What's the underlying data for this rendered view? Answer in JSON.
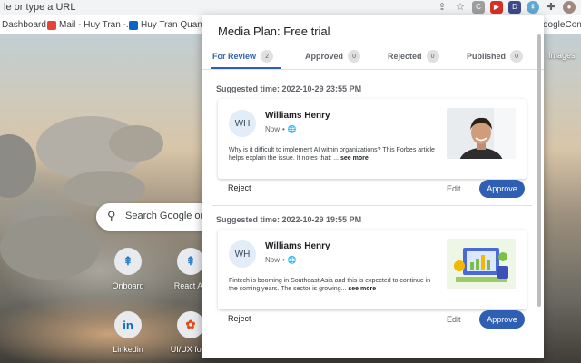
{
  "browser": {
    "omnibox_text": "le or type a URL",
    "toolbar_icons": [
      "share-icon",
      "star-icon",
      "extension-icon",
      "puzzle-icon",
      "profile-icon"
    ],
    "bookmarks": [
      {
        "label": "Dashboard",
        "icon": "dashboard-icon"
      },
      {
        "label": "Mail - Huy Tran -...",
        "icon": "gmail-icon"
      },
      {
        "label": "Huy Tran Quang |...",
        "icon": "linkedin-icon"
      },
      {
        "label": "oogleConso",
        "icon": "google-icon"
      }
    ]
  },
  "ntp": {
    "search_placeholder": "Search Google or ty",
    "images_link": "Images",
    "shortcuts": [
      {
        "label": "Onboard",
        "icon": "onboard-icon",
        "glyph": "⇞"
      },
      {
        "label": "React Ap",
        "icon": "react-icon",
        "glyph": "⇞"
      },
      {
        "label": "Linkedin",
        "icon": "linkedin-icon",
        "glyph": "in"
      },
      {
        "label": "UI/UX for b",
        "icon": "figma-icon",
        "glyph": "✿"
      }
    ]
  },
  "popup": {
    "title": "Media Plan: Free trial",
    "tabs": [
      {
        "label": "For Review",
        "count": "2"
      },
      {
        "label": "Approved",
        "count": "0"
      },
      {
        "label": "Rejected",
        "count": "0"
      },
      {
        "label": "Published",
        "count": "0"
      }
    ],
    "posts": [
      {
        "suggested": "Suggested time: 2022-10-29 23:55 PM",
        "avatar": "WH",
        "author": "Williams Henry",
        "when": "Now",
        "text": "Why is it difficult to implement AI within organizations?  This Forbes article helps explain the issue. It notes that:  ...",
        "see_more": "see more",
        "reject": "Reject",
        "edit": "Edit",
        "approve": "Approve"
      },
      {
        "suggested": "Suggested time: 2022-10-29 19:55 PM",
        "avatar": "WH",
        "author": "Williams Henry",
        "when": "Now",
        "text": "Fintech is booming in Southeast Asia and this is expected to continue in the coming years.  The sector is growing...",
        "see_more": "see more",
        "reject": "Reject",
        "edit": "Edit",
        "approve": "Approve"
      }
    ]
  },
  "colors": {
    "accent": "#2f5fb3",
    "badge_bg": "#e0e0e0"
  }
}
